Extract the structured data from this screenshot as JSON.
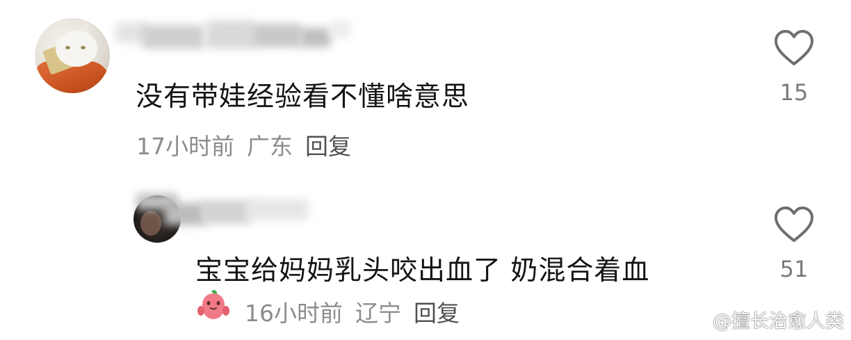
{
  "comments": [
    {
      "text": "没有带娃经验看不懂啥意思",
      "time": "17小时前",
      "location": "广东",
      "reply_label": "回复",
      "likes": "15",
      "avatar_icon": "cat-avatar"
    },
    {
      "text": "宝宝给妈妈乳头咬出血了 奶混合着血",
      "time": "16小时前",
      "location": "辽宁",
      "reply_label": "回复",
      "likes": "51",
      "avatar_icon": "person-avatar",
      "badge_icon": "peach-badge-icon"
    }
  ],
  "watermark": {
    "text": "@擅长治愈人类",
    "icon": "weibo-icon"
  },
  "colors": {
    "text_primary": "#141414",
    "text_meta": "#8c8c8c",
    "reply": "#505050",
    "like_outline": "#6e6e6e",
    "badge_pink": "#f07a86",
    "badge_leaf": "#3fae4c"
  }
}
